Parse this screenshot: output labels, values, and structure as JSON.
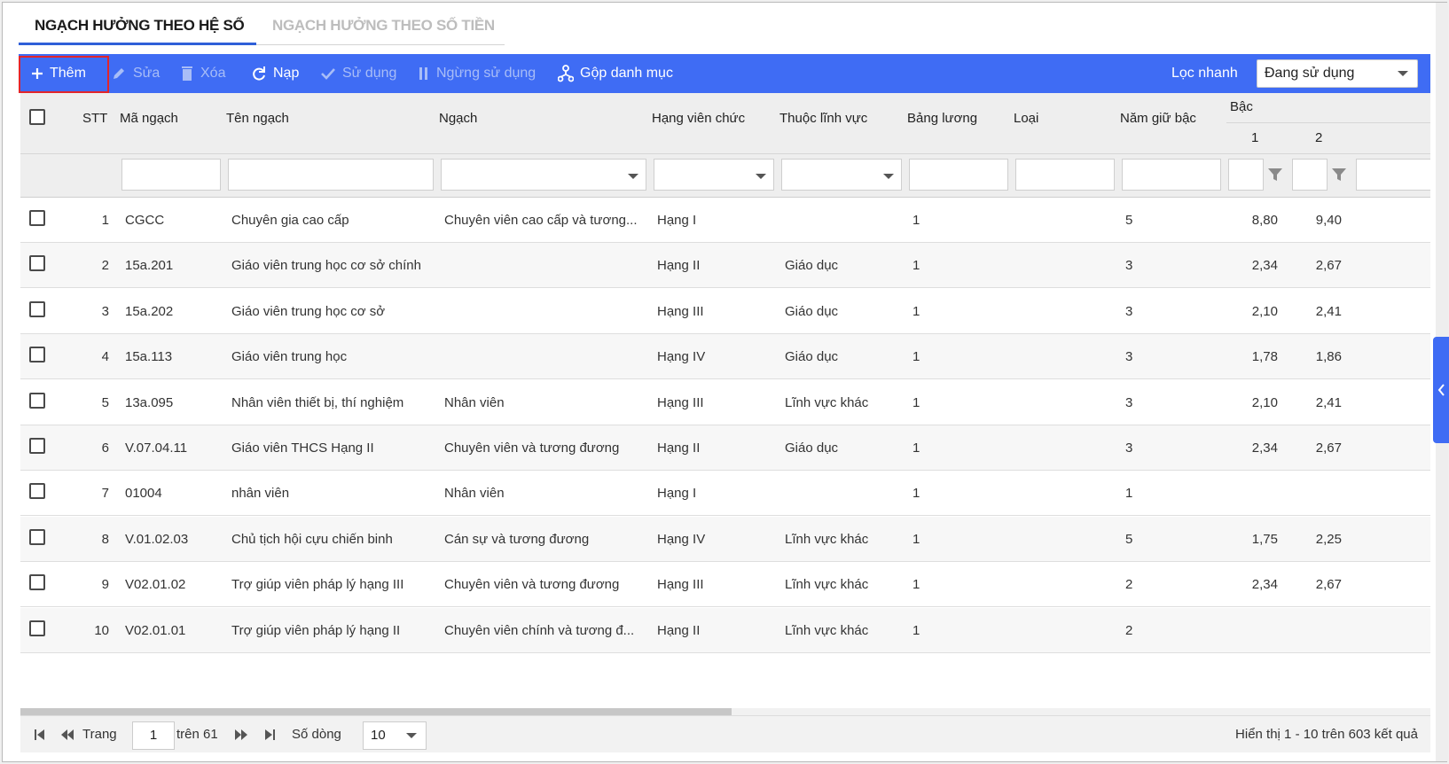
{
  "tabs": [
    {
      "label": "NGẠCH HƯỞNG THEO HỆ SỐ",
      "active": true
    },
    {
      "label": "NGẠCH HƯỞNG THEO SỐ TIỀN",
      "active": false
    }
  ],
  "toolbar": {
    "add": "Thêm",
    "edit": "Sửa",
    "delete": "Xóa",
    "reload": "Nạp",
    "use": "Sử dụng",
    "stop_use": "Ngừng sử dụng",
    "merge": "Gộp danh mục",
    "quick_filter_label": "Lọc nhanh",
    "quick_filter_value": "Đang sử dụng"
  },
  "columns": {
    "stt": "STT",
    "code": "Mã ngạch",
    "name": "Tên ngạch",
    "grade": "Ngạch",
    "rank": "Hạng viên chức",
    "field": "Thuộc lĩnh vực",
    "salary_table": "Bảng lương",
    "type": "Loại",
    "years": "Năm giữ bậc",
    "level": "Bậc",
    "level_1": "1",
    "level_2": "2"
  },
  "rows": [
    {
      "stt": "1",
      "code": "CGCC",
      "name": "Chuyên gia cao cấp",
      "grade": "Chuyên viên cao cấp và tương...",
      "rank": "Hạng I",
      "field": "",
      "salary_table": "1",
      "type": "",
      "years": "5",
      "b1": "8,80",
      "b2": "9,40"
    },
    {
      "stt": "2",
      "code": "15a.201",
      "name": "Giáo viên trung học cơ sở chính",
      "grade": "",
      "rank": "Hạng II",
      "field": "Giáo dục",
      "salary_table": "1",
      "type": "",
      "years": "3",
      "b1": "2,34",
      "b2": "2,67"
    },
    {
      "stt": "3",
      "code": "15a.202",
      "name": "Giáo viên trung học cơ sở",
      "grade": "",
      "rank": "Hạng III",
      "field": "Giáo dục",
      "salary_table": "1",
      "type": "",
      "years": "3",
      "b1": "2,10",
      "b2": "2,41"
    },
    {
      "stt": "4",
      "code": "15a.113",
      "name": "Giáo viên trung học",
      "grade": "",
      "rank": "Hạng IV",
      "field": "Giáo dục",
      "salary_table": "1",
      "type": "",
      "years": "3",
      "b1": "1,78",
      "b2": "1,86"
    },
    {
      "stt": "5",
      "code": "13a.095",
      "name": "Nhân viên thiết bị, thí nghiệm",
      "grade": "Nhân viên",
      "rank": "Hạng III",
      "field": "Lĩnh vực khác",
      "salary_table": "1",
      "type": "",
      "years": "3",
      "b1": "2,10",
      "b2": "2,41"
    },
    {
      "stt": "6",
      "code": "V.07.04.11",
      "name": "Giáo viên THCS Hạng II",
      "grade": "Chuyên viên và tương đương",
      "rank": "Hạng II",
      "field": "Giáo dục",
      "salary_table": "1",
      "type": "",
      "years": "3",
      "b1": "2,34",
      "b2": "2,67"
    },
    {
      "stt": "7",
      "code": "01004",
      "name": "nhân viên",
      "grade": "Nhân viên",
      "rank": "Hạng I",
      "field": "",
      "salary_table": "1",
      "type": "",
      "years": "1",
      "b1": "",
      "b2": ""
    },
    {
      "stt": "8",
      "code": "V.01.02.03",
      "name": "Chủ tịch hội cựu chiến binh",
      "grade": "Cán sự và tương đương",
      "rank": "Hạng IV",
      "field": "Lĩnh vực khác",
      "salary_table": "1",
      "type": "",
      "years": "5",
      "b1": "1,75",
      "b2": "2,25"
    },
    {
      "stt": "9",
      "code": "V02.01.02",
      "name": "Trợ giúp viên pháp lý hạng III",
      "grade": "Chuyên viên và tương đương",
      "rank": "Hạng III",
      "field": "Lĩnh vực khác",
      "salary_table": "1",
      "type": "",
      "years": "2",
      "b1": "2,34",
      "b2": "2,67"
    },
    {
      "stt": "10",
      "code": "V02.01.01",
      "name": "Trợ giúp viên pháp lý hạng II",
      "grade": "Chuyên viên chính và tương đ...",
      "rank": "Hạng II",
      "field": "Lĩnh vực khác",
      "salary_table": "1",
      "type": "",
      "years": "2",
      "b1": "",
      "b2": ""
    }
  ],
  "pagination": {
    "page_label": "Trang",
    "page_value": "1",
    "of_total": "trên 61",
    "rows_label": "Số dòng",
    "rows_value": "10",
    "summary": "Hiển thị 1 - 10 trên 603 kết quả"
  },
  "colors": {
    "toolbar": "#3f6cf4",
    "highlight": "#e2252a",
    "tab_underline": "#2f5fd8"
  }
}
